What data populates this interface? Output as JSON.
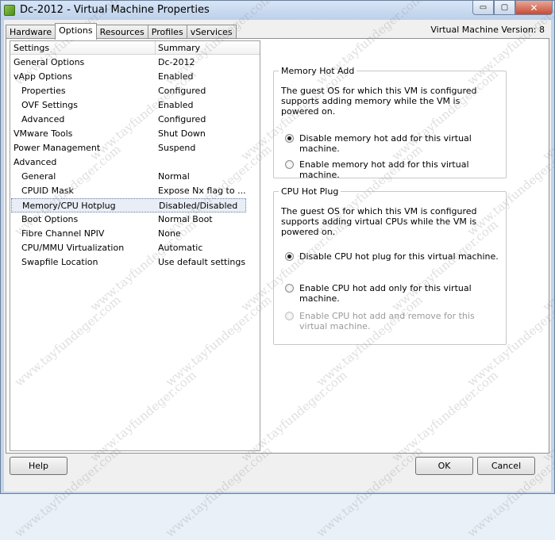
{
  "window": {
    "title": "Dc-2012 - Virtual Machine Properties",
    "minimize_glyph": "▭",
    "maximize_glyph": "▢",
    "close_glyph": "✕"
  },
  "tabs": [
    {
      "label": "Hardware",
      "active": false
    },
    {
      "label": "Options",
      "active": true
    },
    {
      "label": "Resources",
      "active": false
    },
    {
      "label": "Profiles",
      "active": false
    },
    {
      "label": "vServices",
      "active": false
    }
  ],
  "vm_version": "Virtual Machine Version: 8",
  "list": {
    "header": {
      "settings": "Settings",
      "summary": "Summary"
    },
    "rows": [
      {
        "setting": "General Options",
        "summary": "Dc-2012",
        "indent": 0
      },
      {
        "setting": "vApp Options",
        "summary": "Enabled",
        "indent": 0
      },
      {
        "setting": "Properties",
        "summary": "Configured",
        "indent": 1
      },
      {
        "setting": "OVF Settings",
        "summary": "Enabled",
        "indent": 1
      },
      {
        "setting": "Advanced",
        "summary": "Configured",
        "indent": 1
      },
      {
        "setting": "VMware Tools",
        "summary": "Shut Down",
        "indent": 0
      },
      {
        "setting": "Power Management",
        "summary": "Suspend",
        "indent": 0
      },
      {
        "setting": "Advanced",
        "summary": "",
        "indent": 0
      },
      {
        "setting": "General",
        "summary": "Normal",
        "indent": 1
      },
      {
        "setting": "CPUID Mask",
        "summary": "Expose Nx flag to ...",
        "indent": 1
      },
      {
        "setting": "Memory/CPU Hotplug",
        "summary": "Disabled/Disabled",
        "indent": 1,
        "selected": true
      },
      {
        "setting": "Boot Options",
        "summary": "Normal Boot",
        "indent": 1
      },
      {
        "setting": "Fibre Channel NPIV",
        "summary": "None",
        "indent": 1
      },
      {
        "setting": "CPU/MMU Virtualization",
        "summary": "Automatic",
        "indent": 1
      },
      {
        "setting": "Swapfile Location",
        "summary": "Use default settings",
        "indent": 1
      }
    ]
  },
  "memory_hot_add": {
    "title": "Memory Hot Add",
    "description": "The guest OS for which this VM is configured supports adding memory while the VM is powered on.",
    "options": [
      {
        "label": "Disable memory hot add for this virtual machine.",
        "checked": true,
        "disabled": false
      },
      {
        "label": "Enable memory hot add for this virtual machine.",
        "checked": false,
        "disabled": false
      }
    ]
  },
  "cpu_hot_plug": {
    "title": "CPU Hot Plug",
    "description": "The guest OS for which this VM is configured supports adding virtual CPUs while the VM is powered on.",
    "options": [
      {
        "label": "Disable CPU hot plug for this virtual machine.",
        "checked": true,
        "disabled": false
      },
      {
        "label": "Enable CPU hot add only for this virtual machine.",
        "checked": false,
        "disabled": false
      },
      {
        "label": "Enable CPU hot add and remove for this virtual machine.",
        "checked": false,
        "disabled": true
      }
    ]
  },
  "buttons": {
    "help": "Help",
    "ok": "OK",
    "cancel": "Cancel"
  },
  "watermark_text": "www.tayfundeger.com"
}
